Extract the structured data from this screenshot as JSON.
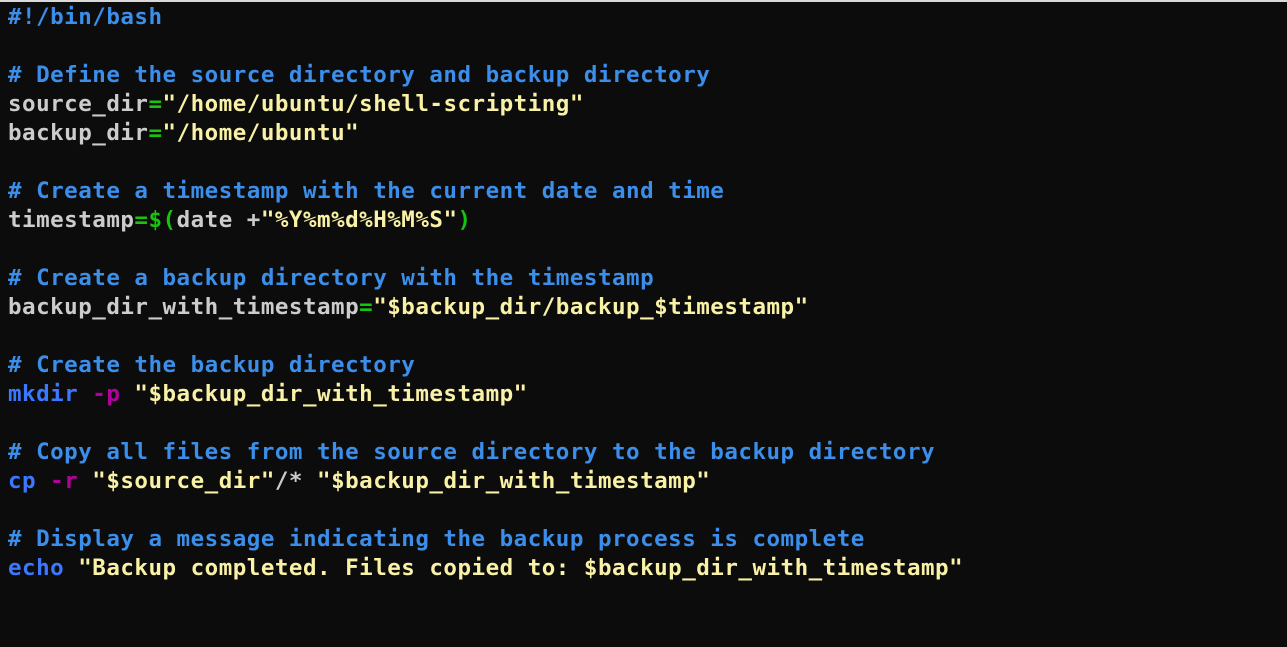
{
  "colors": {
    "background": "#0c0c0c",
    "plain": "#cccccc",
    "comment": "#3b8eea",
    "string": "#f9f1a5",
    "operator": "#16c60c",
    "command": "#3b78ff",
    "option": "#b4009e"
  },
  "editor": {
    "lines": [
      [
        {
          "t": "#!/bin/bash",
          "k": "comment"
        }
      ],
      [],
      [
        {
          "t": "# Define the source directory and backup directory",
          "k": "comment"
        }
      ],
      [
        {
          "t": "source_dir",
          "k": "plain"
        },
        {
          "t": "=",
          "k": "operator"
        },
        {
          "t": "\"/home/ubuntu/shell-scripting\"",
          "k": "string"
        }
      ],
      [
        {
          "t": "backup_dir",
          "k": "plain"
        },
        {
          "t": "=",
          "k": "operator"
        },
        {
          "t": "\"/home/ubuntu\"",
          "k": "string"
        }
      ],
      [],
      [
        {
          "t": "# Create a timestamp with the current date and time",
          "k": "comment"
        }
      ],
      [
        {
          "t": "timestamp",
          "k": "plain"
        },
        {
          "t": "=$(",
          "k": "operator"
        },
        {
          "t": "date +",
          "k": "plain"
        },
        {
          "t": "\"%Y%m%d%H%M%S\"",
          "k": "string"
        },
        {
          "t": ")",
          "k": "operator"
        }
      ],
      [],
      [
        {
          "t": "# Create a backup directory with the timestamp",
          "k": "comment"
        }
      ],
      [
        {
          "t": "backup_dir_with_timestamp",
          "k": "plain"
        },
        {
          "t": "=",
          "k": "operator"
        },
        {
          "t": "\"$backup_dir/backup_$timestamp\"",
          "k": "string"
        }
      ],
      [],
      [
        {
          "t": "# Create the backup directory",
          "k": "comment"
        }
      ],
      [
        {
          "t": "mkdir",
          "k": "command"
        },
        {
          "t": " ",
          "k": "plain"
        },
        {
          "t": "-p",
          "k": "option"
        },
        {
          "t": " ",
          "k": "plain"
        },
        {
          "t": "\"$backup_dir_with_timestamp\"",
          "k": "string"
        }
      ],
      [],
      [
        {
          "t": "# Copy all files from the source directory to the backup directory",
          "k": "comment"
        }
      ],
      [
        {
          "t": "cp",
          "k": "command"
        },
        {
          "t": " ",
          "k": "plain"
        },
        {
          "t": "-r",
          "k": "option"
        },
        {
          "t": " ",
          "k": "plain"
        },
        {
          "t": "\"$source_dir\"",
          "k": "string"
        },
        {
          "t": "/* ",
          "k": "plain"
        },
        {
          "t": "\"$backup_dir_with_timestamp\"",
          "k": "string"
        }
      ],
      [],
      [
        {
          "t": "# Display a message indicating the backup process is complete",
          "k": "comment"
        }
      ],
      [
        {
          "t": "echo",
          "k": "command"
        },
        {
          "t": " ",
          "k": "plain"
        },
        {
          "t": "\"Backup completed. Files copied to: $backup_dir_with_timestamp\"",
          "k": "string"
        }
      ]
    ]
  }
}
